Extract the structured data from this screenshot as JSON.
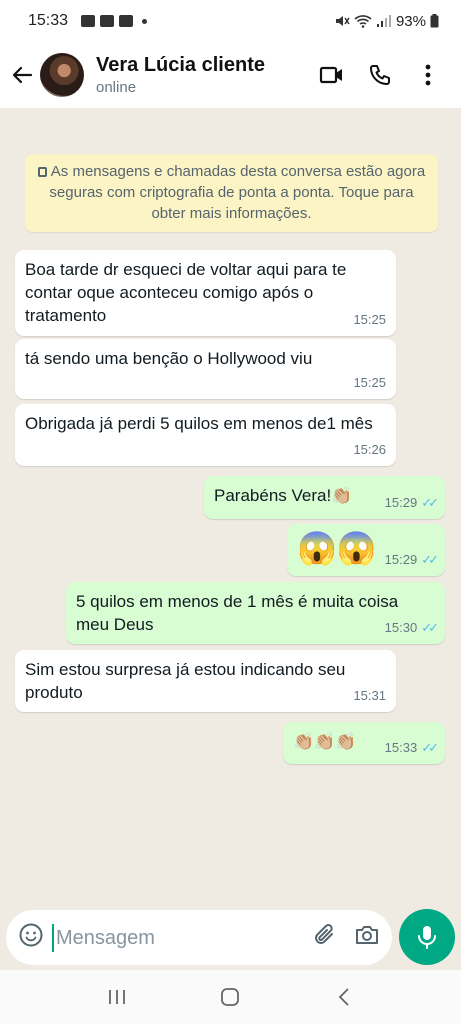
{
  "status_bar": {
    "time": "15:33",
    "battery": "93%"
  },
  "header": {
    "contact_name": "Vera Lúcia cliente",
    "presence": "online"
  },
  "encryption_notice": "As mensagens e chamadas desta conversa estão agora seguras com criptografia de ponta a ponta. Toque para obter mais informações.",
  "messages": [
    {
      "direction": "in",
      "text": "Boa tarde dr esqueci de voltar aqui para te contar oque aconteceu comigo após o tratamento",
      "time": "15:25"
    },
    {
      "direction": "in",
      "text": "tá sendo uma benção o Hollywood viu",
      "time": "15:25"
    },
    {
      "direction": "in",
      "text": "Obrigada já perdi 5 quilos em menos de1 mês",
      "time": "15:26"
    },
    {
      "direction": "out",
      "text": "Parabéns Vera!👏🏼",
      "time": "15:29",
      "read": true
    },
    {
      "direction": "out",
      "text": "😱😱",
      "time": "15:29",
      "read": true
    },
    {
      "direction": "out",
      "text": "5 quilos em menos de 1 mês é muita coisa meu Deus",
      "time": "15:30",
      "read": true
    },
    {
      "direction": "in",
      "text": "Sim estou surpresa já estou indicando seu produto",
      "time": "15:31"
    },
    {
      "direction": "out",
      "text": "👏🏼👏🏼👏🏼",
      "time": "15:33",
      "read": true
    }
  ],
  "composer": {
    "placeholder": "Mensagem"
  },
  "colors": {
    "accent": "#00a884",
    "outgoing_bubble": "#d9fdd3",
    "incoming_bubble": "#ffffff",
    "chat_bg": "#efeae2",
    "notice_bg": "#fdf4c5",
    "read_ticks": "#53bdeb"
  },
  "icons": [
    "back-arrow-icon",
    "video-call-icon",
    "phone-icon",
    "more-vert-icon",
    "lock-icon",
    "emoji-icon",
    "attach-icon",
    "camera-icon",
    "mic-icon",
    "recents-icon",
    "home-icon",
    "back-nav-icon"
  ]
}
